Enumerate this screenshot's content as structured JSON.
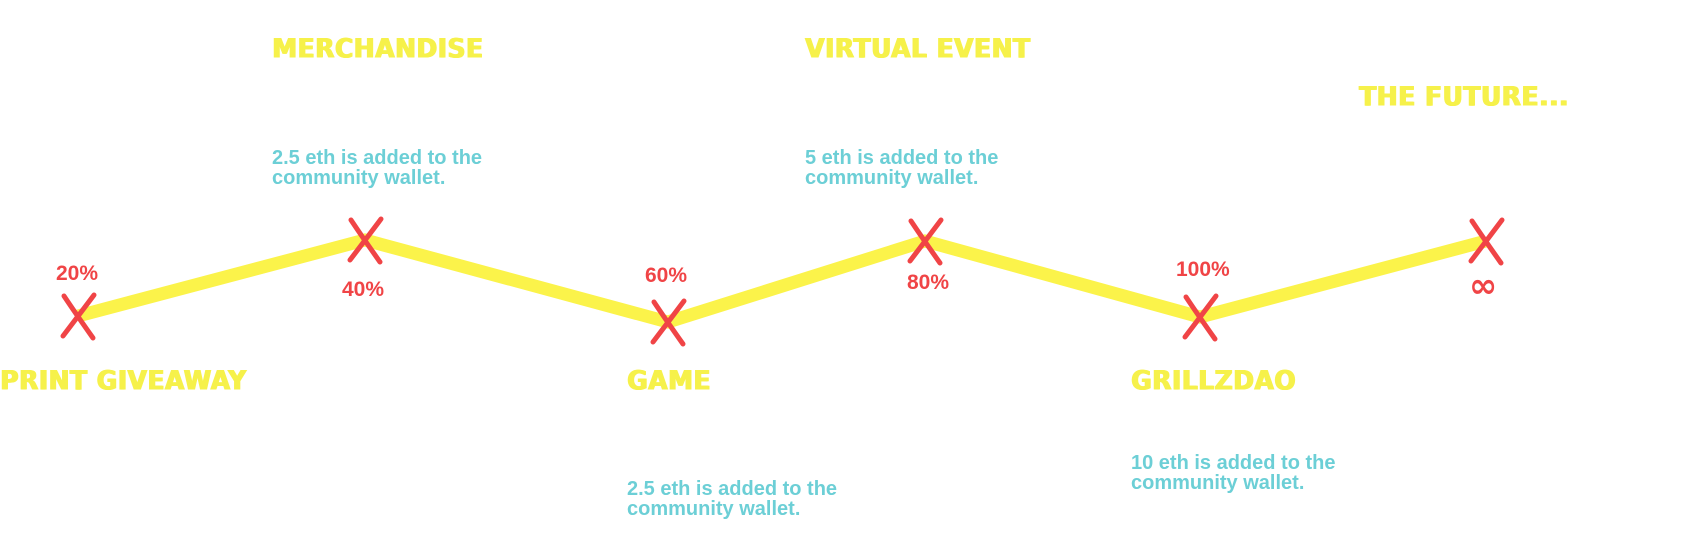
{
  "colors": {
    "path": "#fbf34a",
    "marker": "#f04446",
    "title": "#f6f14a",
    "description": "#6ccfd6",
    "background": "#ffffff"
  },
  "milestones": [
    {
      "percent": "20%",
      "title": "PRINT GIVEAWAY",
      "description": ""
    },
    {
      "percent": "40%",
      "title": "MERCHANDISE",
      "description": "2.5 eth is added to the community wallet."
    },
    {
      "percent": "60%",
      "title": "GAME",
      "description": "2.5 eth is added to the community wallet."
    },
    {
      "percent": "80%",
      "title": "VIRTUAL EVENT",
      "description": "5 eth is added to the community wallet."
    },
    {
      "percent": "100%",
      "title": "GRILLZDAO",
      "description": "10 eth is added to the community wallet."
    },
    {
      "percent": "∞",
      "title": "THE FUTURE...",
      "description": ""
    }
  ]
}
